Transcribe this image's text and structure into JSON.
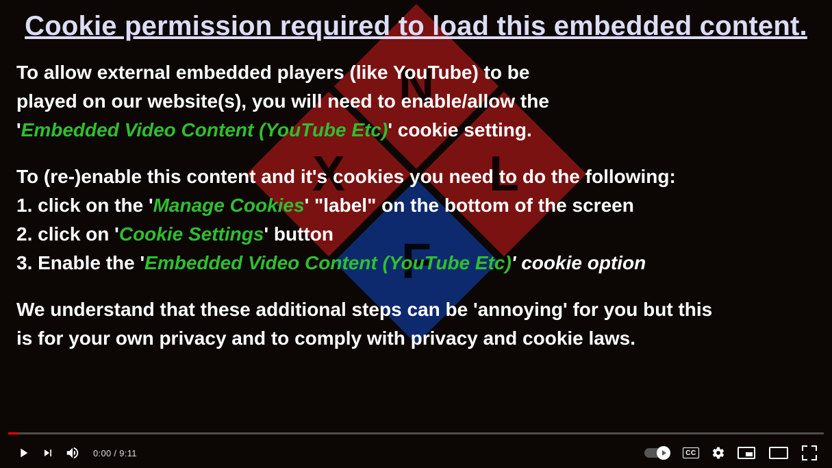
{
  "title": "Cookie permission required to load this embedded content.",
  "para1": {
    "l1": "To allow external embedded players (like YouTube) to be",
    "l2": "played on our website(s), you will need to enable/allow the",
    "l3a": "'",
    "l3g": "Embedded Video Content (YouTube Etc)",
    "l3b": "' cookie setting."
  },
  "para2": {
    "intro": "To (re-)enable this content and it's cookies you need to do the following:",
    "s1a": "1. click on the '",
    "s1g": "Manage Cookies",
    "s1b": "' \"label\" on the bottom of the screen",
    "s2a": "2. click on '",
    "s2g": "Cookie Settings",
    "s2b": "' button",
    "s3a": "3. Enable the '",
    "s3g": "Embedded Video Content (YouTube Etc)",
    "s3b": "' cookie option"
  },
  "para3": {
    "l1": "We understand that these additional steps can be 'annoying' for you but this",
    "l2": "is for your own privacy and to comply with privacy and cookie laws."
  },
  "logo": {
    "n": "N",
    "x": "X",
    "l": "L",
    "f": "F"
  },
  "player": {
    "current": "0:00",
    "sep": " / ",
    "duration": "9:11",
    "cc": "CC"
  }
}
